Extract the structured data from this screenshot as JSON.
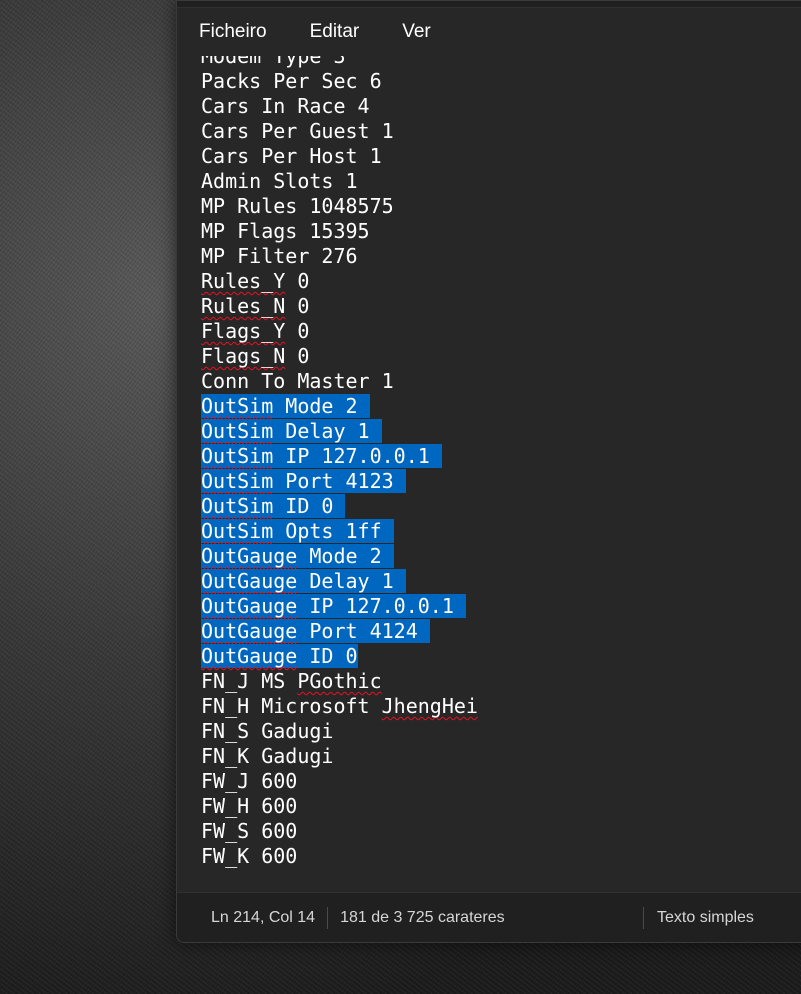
{
  "menu": {
    "file": "Ficheiro",
    "edit": "Editar",
    "view": "Ver"
  },
  "lines": [
    {
      "parts": [
        {
          "t": "Modem Type 3"
        }
      ]
    },
    {
      "parts": [
        {
          "t": "Packs Per Sec 6"
        }
      ]
    },
    {
      "parts": [
        {
          "t": "Cars In Race 4"
        }
      ]
    },
    {
      "parts": [
        {
          "t": "Cars Per Guest 1"
        }
      ]
    },
    {
      "parts": [
        {
          "t": "Cars Per Host 1"
        }
      ]
    },
    {
      "parts": [
        {
          "t": "Admin Slots 1"
        }
      ]
    },
    {
      "parts": [
        {
          "t": "MP Rules 1048575"
        }
      ]
    },
    {
      "parts": [
        {
          "t": "MP Flags 15395"
        }
      ]
    },
    {
      "parts": [
        {
          "t": "MP Filter 276"
        }
      ]
    },
    {
      "parts": [
        {
          "t": "Rules_Y",
          "sq": true
        },
        {
          "t": " 0"
        }
      ]
    },
    {
      "parts": [
        {
          "t": "Rules_N",
          "sq": true
        },
        {
          "t": " 0"
        }
      ]
    },
    {
      "parts": [
        {
          "t": "Flags_Y",
          "sq": true
        },
        {
          "t": " 0"
        }
      ]
    },
    {
      "parts": [
        {
          "t": "Flags_N",
          "sq": true
        },
        {
          "t": " 0"
        }
      ]
    },
    {
      "parts": [
        {
          "t": "Conn To Master 1"
        }
      ]
    },
    {
      "sel": true,
      "parts": [
        {
          "t": "OutSim",
          "sq": true
        },
        {
          "t": " Mode 2"
        }
      ]
    },
    {
      "sel": true,
      "parts": [
        {
          "t": "OutSim",
          "sq": true
        },
        {
          "t": " Delay 1"
        }
      ]
    },
    {
      "sel": true,
      "parts": [
        {
          "t": "OutSim",
          "sq": true
        },
        {
          "t": " IP 127.0.0.1"
        }
      ]
    },
    {
      "sel": true,
      "parts": [
        {
          "t": "OutSim",
          "sq": true
        },
        {
          "t": " Port 4123"
        }
      ]
    },
    {
      "sel": true,
      "parts": [
        {
          "t": "OutSim",
          "sq": true
        },
        {
          "t": " ID 0"
        }
      ]
    },
    {
      "sel": true,
      "parts": [
        {
          "t": "OutSim",
          "sq": true
        },
        {
          "t": " Opts 1ff"
        }
      ]
    },
    {
      "sel": true,
      "parts": [
        {
          "t": "OutGauge",
          "sq": true
        },
        {
          "t": " Mode 2"
        }
      ]
    },
    {
      "sel": true,
      "parts": [
        {
          "t": "OutGauge",
          "sq": true
        },
        {
          "t": " Delay 1"
        }
      ]
    },
    {
      "sel": true,
      "parts": [
        {
          "t": "OutGauge",
          "sq": true
        },
        {
          "t": " IP 127.0.0.1"
        }
      ]
    },
    {
      "sel": true,
      "parts": [
        {
          "t": "OutGauge",
          "sq": true
        },
        {
          "t": " Port 4124"
        }
      ]
    },
    {
      "sel": true,
      "last": true,
      "parts": [
        {
          "t": "OutGauge",
          "sq": true
        },
        {
          "t": " ID 0"
        }
      ]
    },
    {
      "parts": [
        {
          "t": "FN_J MS "
        },
        {
          "t": "PGothic",
          "sq": true
        }
      ]
    },
    {
      "parts": [
        {
          "t": "FN_H Microsoft "
        },
        {
          "t": "JhengHei",
          "sq": true
        }
      ]
    },
    {
      "parts": [
        {
          "t": "FN_S Gadugi"
        }
      ]
    },
    {
      "parts": [
        {
          "t": "FN_K Gadugi"
        }
      ]
    },
    {
      "parts": [
        {
          "t": "FW_J 600"
        }
      ]
    },
    {
      "parts": [
        {
          "t": "FW_H 600"
        }
      ]
    },
    {
      "parts": [
        {
          "t": "FW_S 600"
        }
      ]
    },
    {
      "parts": [
        {
          "t": "FW_K 600"
        }
      ]
    }
  ],
  "status": {
    "position": "Ln 214, Col 14",
    "count": "181 de 3 725 carateres",
    "format": "Texto simples"
  },
  "colors": {
    "selection": "#0067c0",
    "spellcheck": "#e81123",
    "editor_bg": "#272727"
  }
}
